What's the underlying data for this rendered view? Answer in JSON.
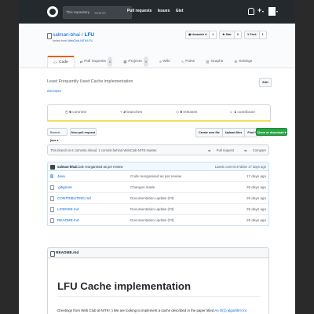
{
  "header": {
    "search_scope": "This repository",
    "search_placeholder": "Search",
    "nav": [
      "Pull requests",
      "Issues",
      "Gist"
    ],
    "plus": "+"
  },
  "repo": {
    "owner": "salman-bhai",
    "name": "LFU",
    "forked_prefix": "forked from",
    "forked_from": "WebClub-NITK/LFU",
    "unwatch_label": "Unwatch",
    "unwatch_count": "1",
    "star_label": "Star",
    "star_count": "0",
    "fork_label": "Fork",
    "fork_count": "1"
  },
  "tabs": [
    {
      "label": "Code",
      "icon": "code-icon"
    },
    {
      "label": "Pull requests",
      "count": "0",
      "icon": "pr-icon"
    },
    {
      "label": "Projects",
      "count": "0",
      "icon": "project-icon"
    },
    {
      "label": "Wiki",
      "icon": "wiki-icon"
    },
    {
      "label": "Pulse",
      "icon": "pulse-icon"
    },
    {
      "label": "Graphs",
      "icon": "graph-icon"
    },
    {
      "label": "Settings",
      "icon": "gear-icon"
    }
  ],
  "description": "Least Frequently Used Cache implementation",
  "add_topics": "Add topics",
  "edit_label": "Edit",
  "summary": {
    "commits_count": "6",
    "commits_label": "commits",
    "branches_count": "2",
    "branches_label": "branches",
    "releases_count": "0",
    "releases_label": "releases",
    "contributors_count": "1",
    "contributors_label": "contributor"
  },
  "language_color": "#f1e05a",
  "branch": {
    "prefix": "Branch:",
    "name": "java"
  },
  "new_pr_label": "New pull request",
  "file_buttons": [
    "Create new file",
    "Upload files",
    "Find file"
  ],
  "clone_label": "Clone or download",
  "ahead_text": "This branch is 6 commits ahead, 1 commit behind WebClub-NITK:master.",
  "ahead_links": {
    "pr": "Pull request",
    "compare": "Compare"
  },
  "commit": {
    "author": "salman-bhai",
    "message": "Code reorganised as per review",
    "latest": "Latest commit 47d25e 17 days ago"
  },
  "files": [
    {
      "name": "Java",
      "type": "dir",
      "msg": "Code reorganised as per review",
      "age": "17 days ago"
    },
    {
      "name": ".gitignore",
      "type": "file",
      "msg": "Changes made",
      "age": "26 days ago"
    },
    {
      "name": "CONTRIBUTING.md",
      "type": "file",
      "msg": "Documentation update (#3)",
      "age": "25 days ago"
    },
    {
      "name": "LICENSE.md",
      "type": "file",
      "msg": "Documentation update (#3)",
      "age": "25 days ago"
    },
    {
      "name": "README.md",
      "type": "file",
      "msg": "Documentation update (#3)",
      "age": "25 days ago"
    }
  ],
  "readme": {
    "filename": "README.md",
    "title": "LFU Cache implementation",
    "text": "Greetings from Web Club at NITK! :) We are looking to implement a cache described in the paper titled",
    "text_link": "An O(1) algorithm for"
  }
}
